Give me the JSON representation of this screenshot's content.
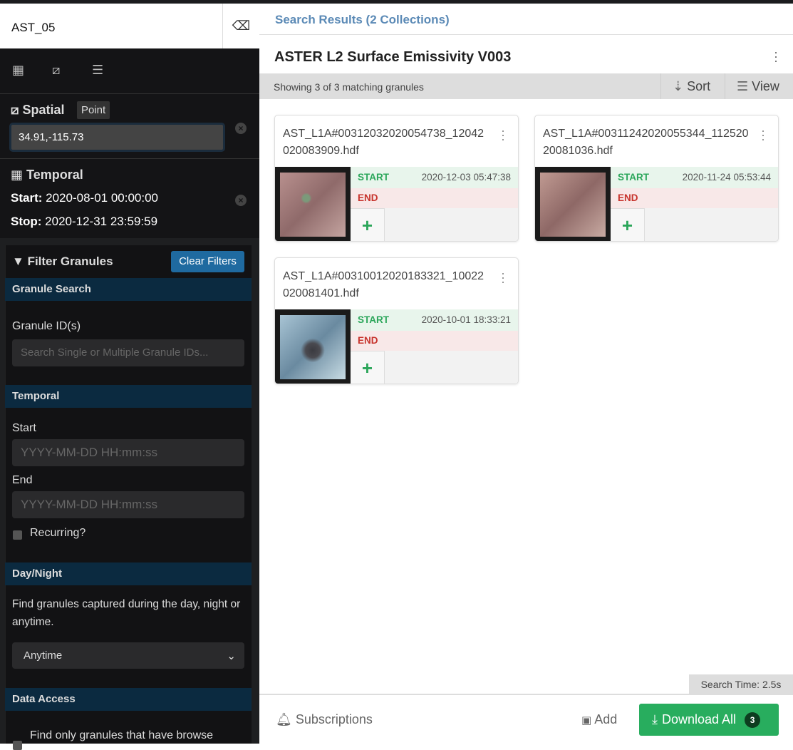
{
  "search": {
    "keyword": "AST_05"
  },
  "sidebar": {
    "spatial": {
      "title": "Spatial",
      "type_badge": "Point",
      "value": "34.91,-115.73"
    },
    "temporal": {
      "title": "Temporal",
      "start_label": "Start:",
      "start": "2020-08-01 00:00:00",
      "stop_label": "Stop:",
      "stop": "2020-12-31 23:59:59"
    },
    "filters": {
      "title": "Filter Granules",
      "clear": "Clear Filters",
      "granule_search": {
        "header": "Granule Search",
        "label": "Granule ID(s)",
        "placeholder": "Search Single or Multiple Granule IDs..."
      },
      "temporal": {
        "header": "Temporal",
        "start_label": "Start",
        "end_label": "End",
        "placeholder": "YYYY-MM-DD HH:mm:ss",
        "recurring": "Recurring?"
      },
      "day_night": {
        "header": "Day/Night",
        "desc": "Find granules captured during the day, night or anytime.",
        "selected": "Anytime"
      },
      "data_access": {
        "header": "Data Access",
        "browse_label": "Find only granules that have browse"
      }
    }
  },
  "main": {
    "breadcrumb": "Search Results (2 Collections)",
    "collection_title": "ASTER L2 Surface Emissivity V003",
    "showing": "Showing 3 of 3 matching granules",
    "sort": "Sort",
    "view": "View",
    "start_label": "START",
    "end_label": "END",
    "granules": [
      {
        "name": "AST_L1A#00312032020054738_12042020083909.hdf",
        "start": "2020-12-03 05:47:38",
        "end": ""
      },
      {
        "name": "AST_L1A#00311242020055344_11252020081036.hdf",
        "start": "2020-11-24 05:53:44",
        "end": ""
      },
      {
        "name": "AST_L1A#00310012020183321_10022020081401.hdf",
        "start": "2020-10-01 18:33:21",
        "end": ""
      }
    ],
    "search_time": "Search Time: 2.5s",
    "footer": {
      "subscriptions": "Subscriptions",
      "add": "Add",
      "download_all": "Download All",
      "download_count": "3"
    }
  },
  "colors": {
    "accent": "#28ad5e",
    "section_header": "#0b2a40",
    "clear_button": "#1f6aa0",
    "link": "#5b8ab6"
  }
}
